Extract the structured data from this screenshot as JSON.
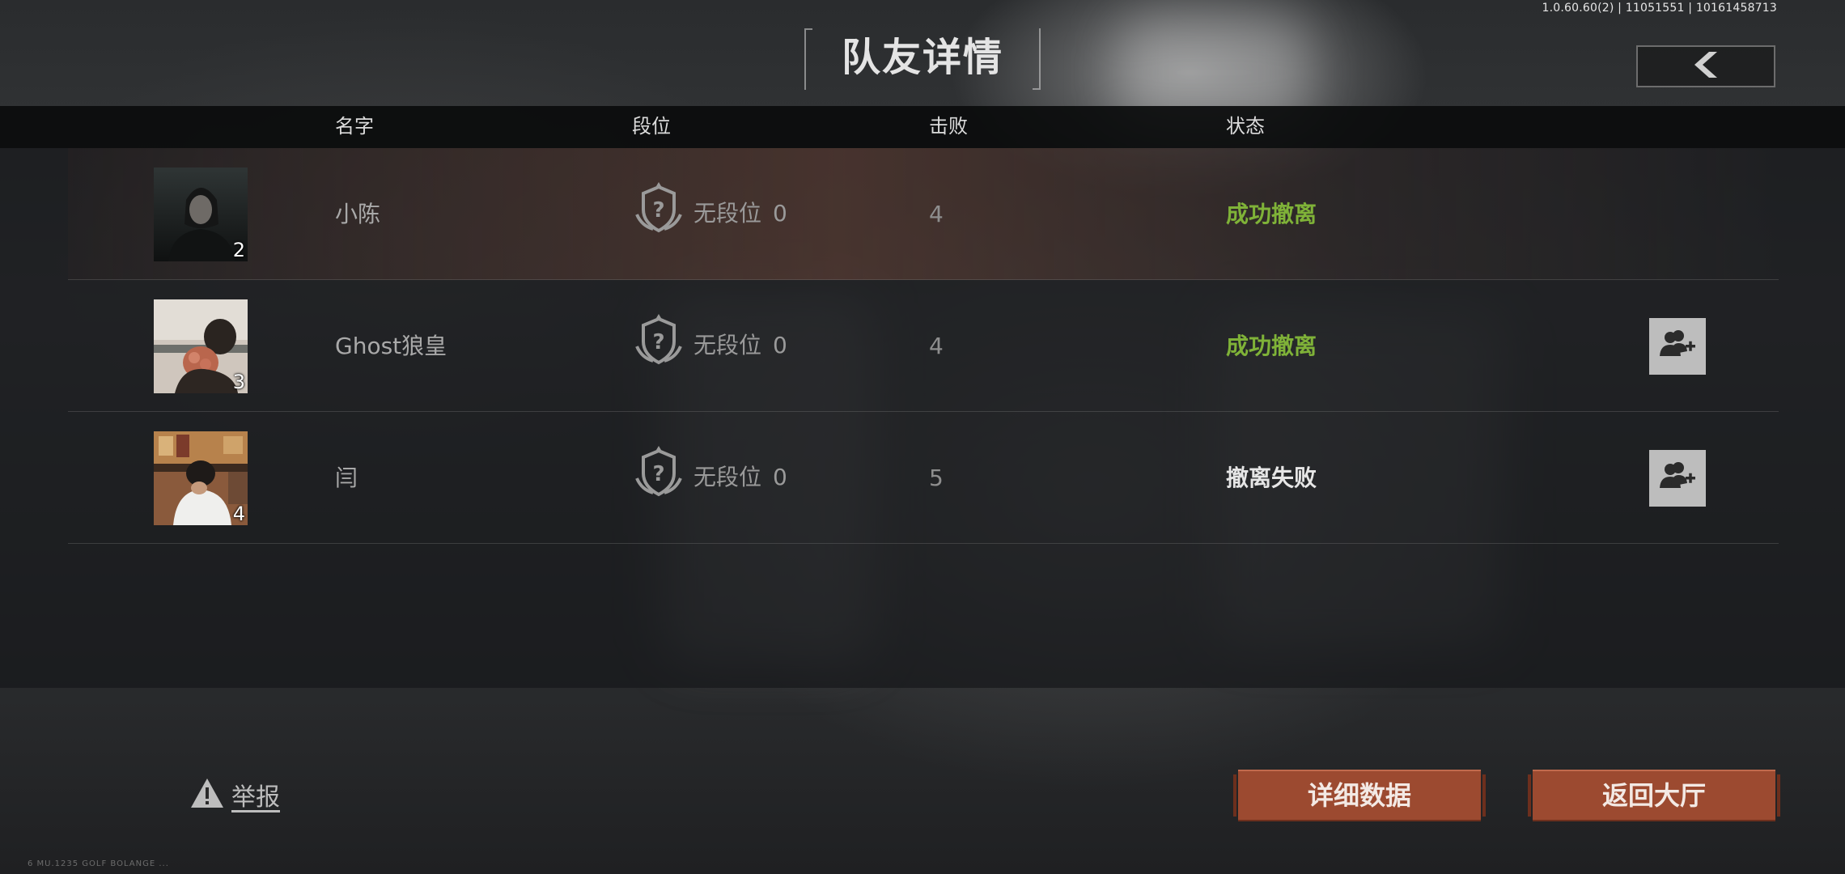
{
  "version_info": "1.0.60.60(2) | 11051551 | 10161458713",
  "title": "队友详情",
  "back_button": {
    "icon": "chevron-left-icon"
  },
  "columns": {
    "name": "名字",
    "rank": "段位",
    "kills": "击败",
    "status": "状态"
  },
  "teammates": [
    {
      "slot": "2",
      "name": "小陈",
      "rank_label": "无段位",
      "rank_points": "0",
      "kills": "4",
      "status": "成功撤离",
      "status_type": "success",
      "can_add_friend": false
    },
    {
      "slot": "3",
      "name": "Ghost狼皇",
      "rank_label": "无段位",
      "rank_points": "0",
      "kills": "4",
      "status": "成功撤离",
      "status_type": "success",
      "can_add_friend": true
    },
    {
      "slot": "4",
      "name": "闫",
      "rank_label": "无段位",
      "rank_points": "0",
      "kills": "5",
      "status": "撤离失败",
      "status_type": "fail",
      "can_add_friend": true
    }
  ],
  "report_label": "举报",
  "buttons": {
    "details": "详细数据",
    "lobby": "返回大厅"
  },
  "colors": {
    "success": "#7fb238",
    "button": "#9c4a30"
  },
  "footer_text": "6 MU.1235 GOLF BOLANGE ..."
}
